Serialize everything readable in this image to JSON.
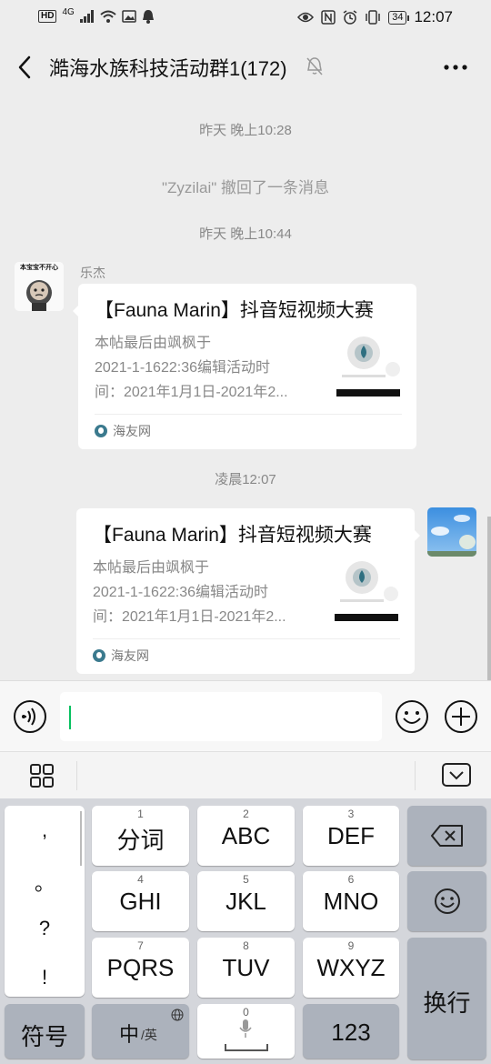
{
  "status_bar": {
    "network": "4G",
    "battery": "34",
    "time": "12:07"
  },
  "header": {
    "title": "澔海水族科技活动群1(172)"
  },
  "messages": {
    "time1": "昨天 晚上10:28",
    "recall_notice": "\"Zyzilai\" 撤回了一条消息",
    "time2": "昨天 晚上10:44",
    "sender1": "乐杰",
    "avatar1_caption": "本宝宝不开心",
    "card1": {
      "title": "【Fauna Marin】抖音短视频大赛",
      "desc_line1": "本帖最后由飒枫于",
      "desc_line2": "2021-1-1622:36编辑活动时",
      "desc_line3": "间：2021年1月1日-2021年2...",
      "source": "海友网"
    },
    "time3": "凌晨12:07",
    "card2": {
      "title": "【Fauna Marin】抖音短视频大赛",
      "desc_line1": "本帖最后由飒枫于",
      "desc_line2": "2021-1-1622:36编辑活动时",
      "desc_line3": "间：2021年1月1日-2021年2...",
      "source": "海友网"
    }
  },
  "keyboard": {
    "punct": [
      ",",
      "。",
      "?",
      "!"
    ],
    "keys": [
      {
        "num": "1",
        "label": "分词"
      },
      {
        "num": "2",
        "label": "ABC"
      },
      {
        "num": "3",
        "label": "DEF"
      },
      {
        "num": "4",
        "label": "GHI"
      },
      {
        "num": "5",
        "label": "JKL"
      },
      {
        "num": "6",
        "label": "MNO"
      },
      {
        "num": "7",
        "label": "PQRS"
      },
      {
        "num": "8",
        "label": "TUV"
      },
      {
        "num": "9",
        "label": "WXYZ"
      }
    ],
    "enter_label": "换行",
    "symbol_label": "符号",
    "lang_main": "中",
    "lang_sub": "/英",
    "space_num": "0",
    "num_label": "123"
  },
  "colors": {
    "accent": "#07c160",
    "background": "#ededed",
    "keyboard": "#d4d6db"
  }
}
